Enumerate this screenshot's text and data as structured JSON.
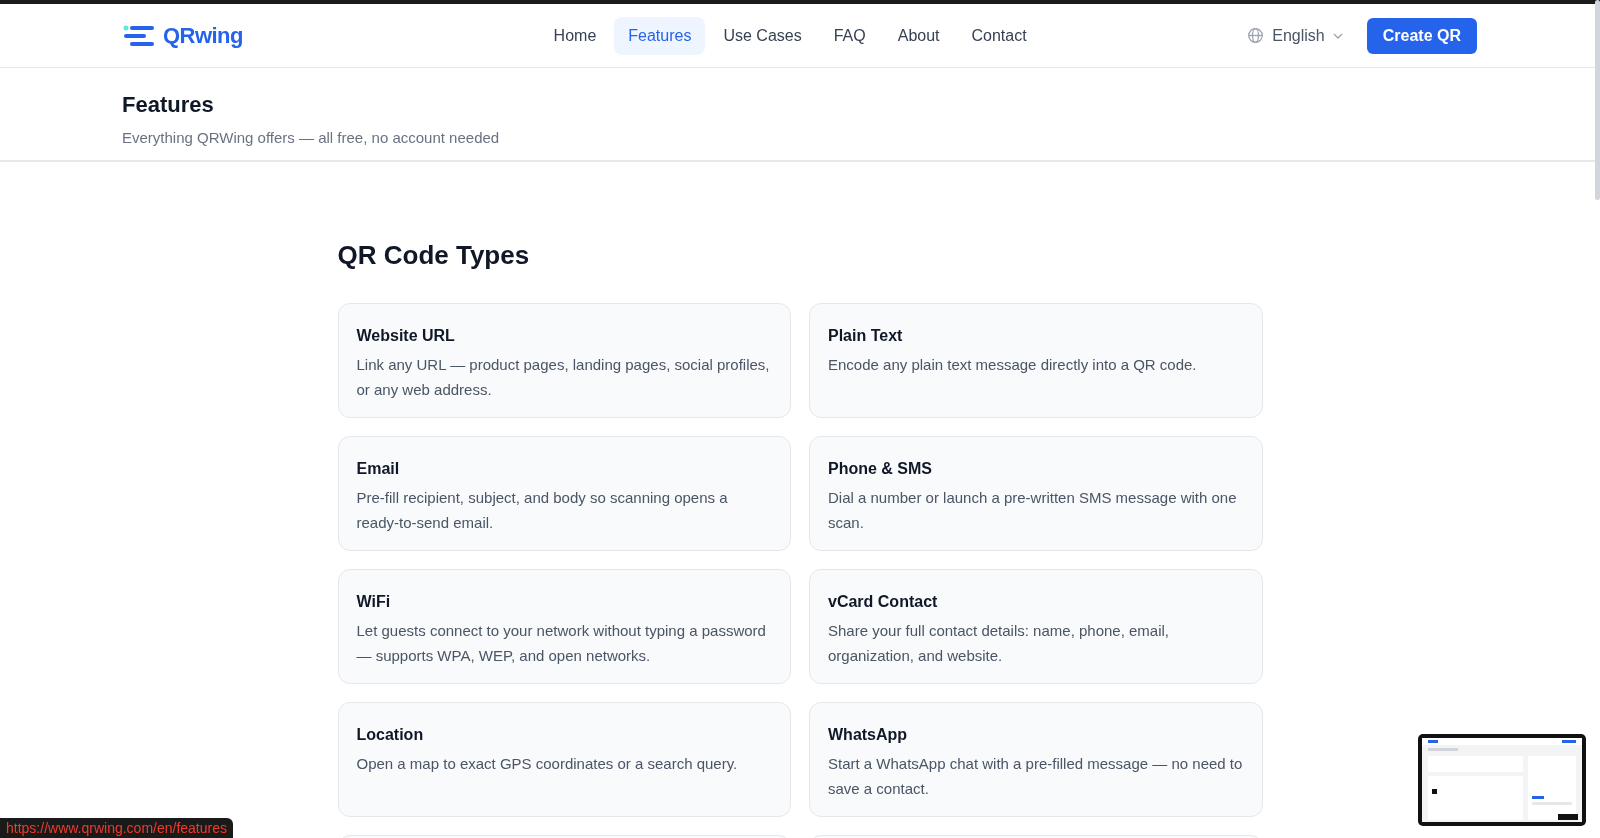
{
  "brand": {
    "name": "QRwing"
  },
  "nav": [
    {
      "label": "Home",
      "selected": false
    },
    {
      "label": "Features",
      "selected": true
    },
    {
      "label": "Use Cases",
      "selected": false
    },
    {
      "label": "FAQ",
      "selected": false
    },
    {
      "label": "About",
      "selected": false
    },
    {
      "label": "Contact",
      "selected": false
    }
  ],
  "language": {
    "label": "English"
  },
  "cta": {
    "label": "Create QR"
  },
  "page_header": {
    "title": "Features",
    "subtitle": "Everything QRWing offers — all free, no account needed"
  },
  "section": {
    "title": "QR Code Types",
    "cards": [
      {
        "title": "Website URL",
        "text": "Link any URL — product pages, landing pages, social profiles, or any web address."
      },
      {
        "title": "Plain Text",
        "text": "Encode any plain text message directly into a QR code."
      },
      {
        "title": "Email",
        "text": "Pre-fill recipient, subject, and body so scanning opens a ready-to-send email."
      },
      {
        "title": "Phone & SMS",
        "text": "Dial a number or launch a pre-written SMS message with one scan."
      },
      {
        "title": "WiFi",
        "text": "Let guests connect to your network without typing a password — supports WPA, WEP, and open networks."
      },
      {
        "title": "vCard Contact",
        "text": "Share your full contact details: name, phone, email, organization, and website."
      },
      {
        "title": "Location",
        "text": "Open a map to exact GPS coordinates or a search query."
      },
      {
        "title": "WhatsApp",
        "text": "Start a WhatsApp chat with a pre-filled message — no need to save a contact."
      }
    ]
  },
  "status_url": "https://www.qrwing.com/en/features"
}
